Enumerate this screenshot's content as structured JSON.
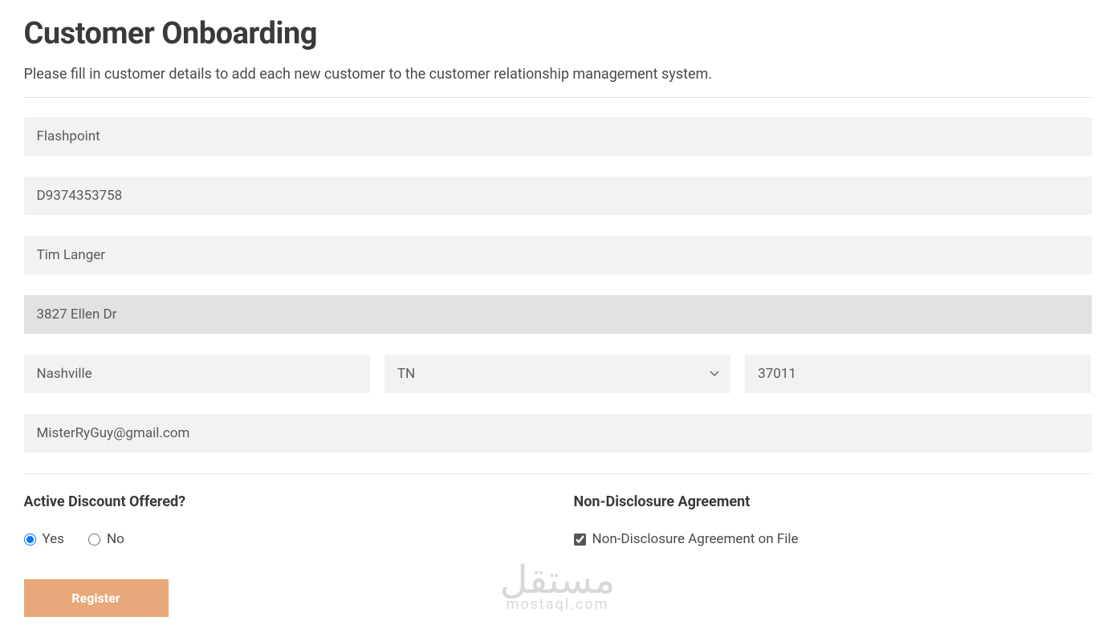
{
  "header": {
    "title": "Customer Onboarding",
    "subtitle": "Please fill in customer details to add each new customer to the customer relationship management system."
  },
  "form": {
    "company": "Flashpoint",
    "customerId": "D9374353758",
    "contactName": "Tim Langer",
    "address": "3827 Ellen Dr",
    "city": "Nashville",
    "state": "TN",
    "zip": "37011",
    "email": "MisterRyGuy@gmail.com"
  },
  "sections": {
    "discount": {
      "heading": "Active Discount Offered?",
      "yesLabel": "Yes",
      "noLabel": "No",
      "selected": "yes"
    },
    "nda": {
      "heading": "Non-Disclosure Agreement",
      "checkboxLabel": "Non-Disclosure Agreement on File",
      "checked": true
    }
  },
  "buttons": {
    "register": "Register"
  },
  "watermark": {
    "main": "مستقل",
    "sub": "mostaql.com"
  }
}
